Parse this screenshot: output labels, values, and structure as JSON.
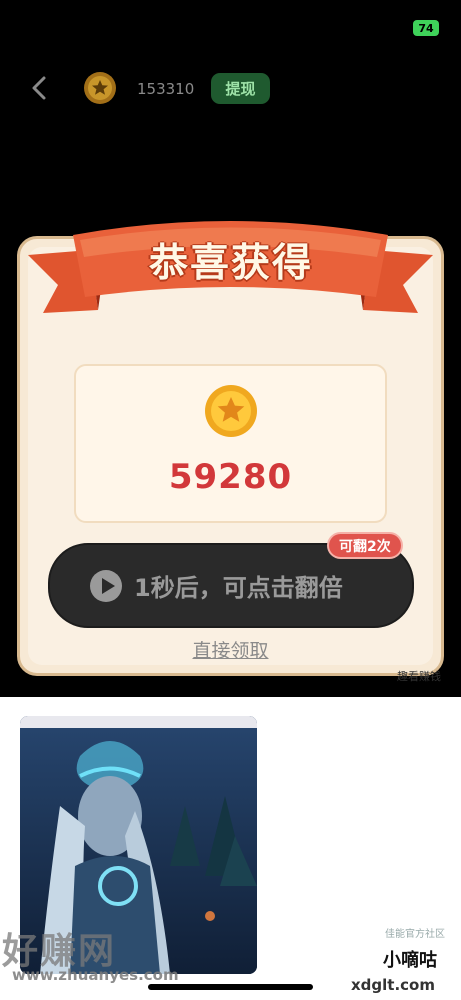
{
  "status_bar": {
    "battery": "74"
  },
  "header": {
    "coin_count": "153310",
    "withdraw_label": "提现"
  },
  "modal": {
    "title": "恭喜获得",
    "reward_amount": "59280",
    "double_button_label": "1秒后，可点击翻倍",
    "double_badge": "可翻2次",
    "direct_claim_label": "直接领取",
    "small_watermark": "趣看赚钱"
  },
  "ad": {
    "corner_text": "佳能官方社区"
  },
  "watermarks": {
    "xiao_badge": "小嘀咕",
    "site_url": "xdglt.com",
    "brand_logo": "好赚网",
    "brand_url": "www.zhuanyes.com"
  },
  "colors": {
    "accent_red": "#d2383a",
    "withdraw_green": "#1f5a2f",
    "battery_green": "#3fd25a"
  }
}
